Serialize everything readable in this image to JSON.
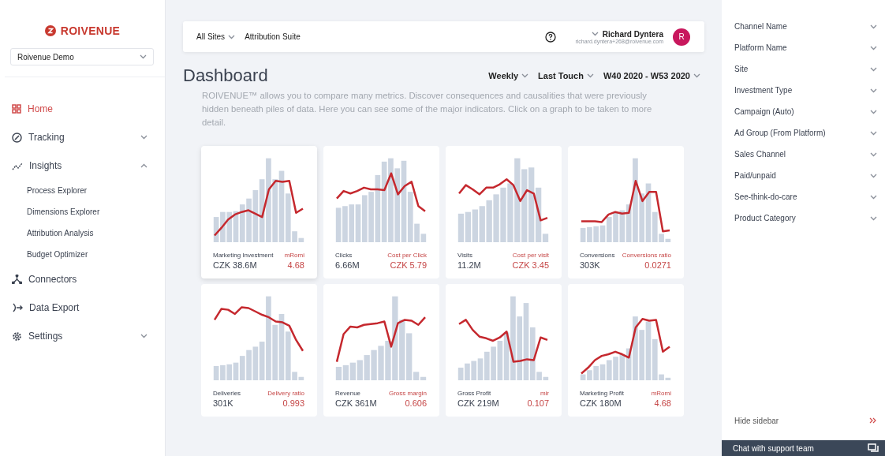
{
  "sidebar": {
    "logo": "ROIVENUE",
    "site_select": {
      "value": "Roivenue Demo"
    },
    "items": [
      {
        "label": "Home",
        "kind": "link",
        "selected": true
      },
      {
        "label": "Tracking",
        "kind": "group",
        "selected": false,
        "expanded": false
      },
      {
        "label": "Insights",
        "kind": "group",
        "selected": false,
        "expanded": true,
        "children": [
          {
            "label": "Process Explorer",
            "selected": false
          },
          {
            "label": "Dimensions Explorer",
            "selected": false
          },
          {
            "label": "Attribution Analysis",
            "selected": false
          },
          {
            "label": "Budget Optimizer",
            "selected": false
          }
        ]
      },
      {
        "label": "Connectors",
        "kind": "link",
        "selected": false
      },
      {
        "label": "Data Export",
        "kind": "link",
        "selected": false
      },
      {
        "label": "Settings",
        "kind": "group",
        "selected": false,
        "expanded": false
      }
    ]
  },
  "header": {
    "site_menu": "All Sites",
    "suite": "Attribution Suite",
    "user_name": "Richard Dyntera",
    "user_email": "richard.dyntera+268@roivenue.com",
    "avatar": "R"
  },
  "page": {
    "title": "Dashboard",
    "filters": [
      "Weekly",
      "Last Touch",
      "W40 2020 - W53 2020"
    ],
    "description": "ROIVENUE™ allows you to compare many metrics. Discover consequences and causalities that were previously hidden beneath piles of data. Here you can see some of the major indicators. Click on a graph to be taken to more detail."
  },
  "cards": [
    {
      "metric": "Marketing Investment",
      "value": "CZK 38.6M",
      "ratio_label": "mRomi",
      "ratio": "4.68",
      "selected": true
    },
    {
      "metric": "Clicks",
      "value": "6.66M",
      "ratio_label": "Cost per Click",
      "ratio": "CZK 5.79",
      "selected": false
    },
    {
      "metric": "Visits",
      "value": "11.2M",
      "ratio_label": "Cost per visit",
      "ratio": "CZK 3.45",
      "selected": false
    },
    {
      "metric": "Conversions",
      "value": "303K",
      "ratio_label": "Conversions ratio",
      "ratio": "0.0271",
      "selected": false
    },
    {
      "metric": "Deliveries",
      "value": "301K",
      "ratio_label": "Delivery ratio",
      "ratio": "0.993",
      "selected": false
    },
    {
      "metric": "Revenue",
      "value": "CZK 361M",
      "ratio_label": "Gross margin",
      "ratio": "0.606",
      "selected": false
    },
    {
      "metric": "Gross Profit",
      "value": "CZK 219M",
      "ratio_label": "mir",
      "ratio": "0.107",
      "selected": false
    },
    {
      "metric": "Marketing Profit",
      "value": "CZK 180M",
      "ratio_label": "mRomi",
      "ratio": "4.68",
      "selected": false
    }
  ],
  "filter_panel": {
    "filters": [
      {
        "label": "Channel Name",
        "expanded": false
      },
      {
        "label": "Platform Name",
        "expanded": false
      },
      {
        "label": "Site",
        "expanded": false
      },
      {
        "label": "Investment Type",
        "expanded": false
      },
      {
        "label": "Campaign (Auto)",
        "expanded": false
      },
      {
        "label": "Ad Group (From Platform)",
        "expanded": false
      },
      {
        "label": "Sales Channel",
        "expanded": false
      },
      {
        "label": "Paid/unpaid",
        "expanded": false
      },
      {
        "label": "See-think-do-care",
        "expanded": false
      },
      {
        "label": "Product Category",
        "expanded": false
      }
    ],
    "hide_label": "Hide sidebar",
    "chat_label": "Chat with support team"
  }
}
